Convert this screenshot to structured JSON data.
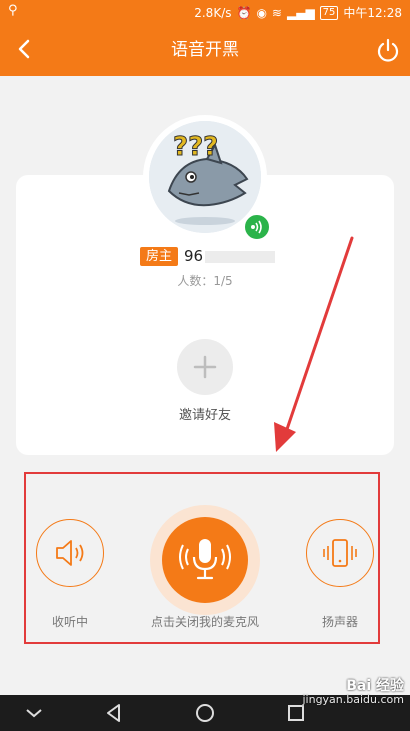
{
  "status": {
    "speed": "2.8K/s",
    "battery": "75",
    "time": "中午12:28"
  },
  "header": {
    "title": "语音开黑"
  },
  "room": {
    "owner_badge": "房主",
    "owner_id": "96",
    "count": "人数：1/5",
    "invite_label": "邀请好友",
    "avatar_text": "???"
  },
  "controls": {
    "listen_label": "收听中",
    "mic_label": "点击关闭我的麦克风",
    "speaker_label": "扬声器"
  },
  "watermark": {
    "brand": "Bai 经验",
    "url": "jingyan.baidu.com"
  },
  "colors": {
    "accent": "#f47a17",
    "annotation": "#e23b3b",
    "speaking": "#2bb34a"
  }
}
